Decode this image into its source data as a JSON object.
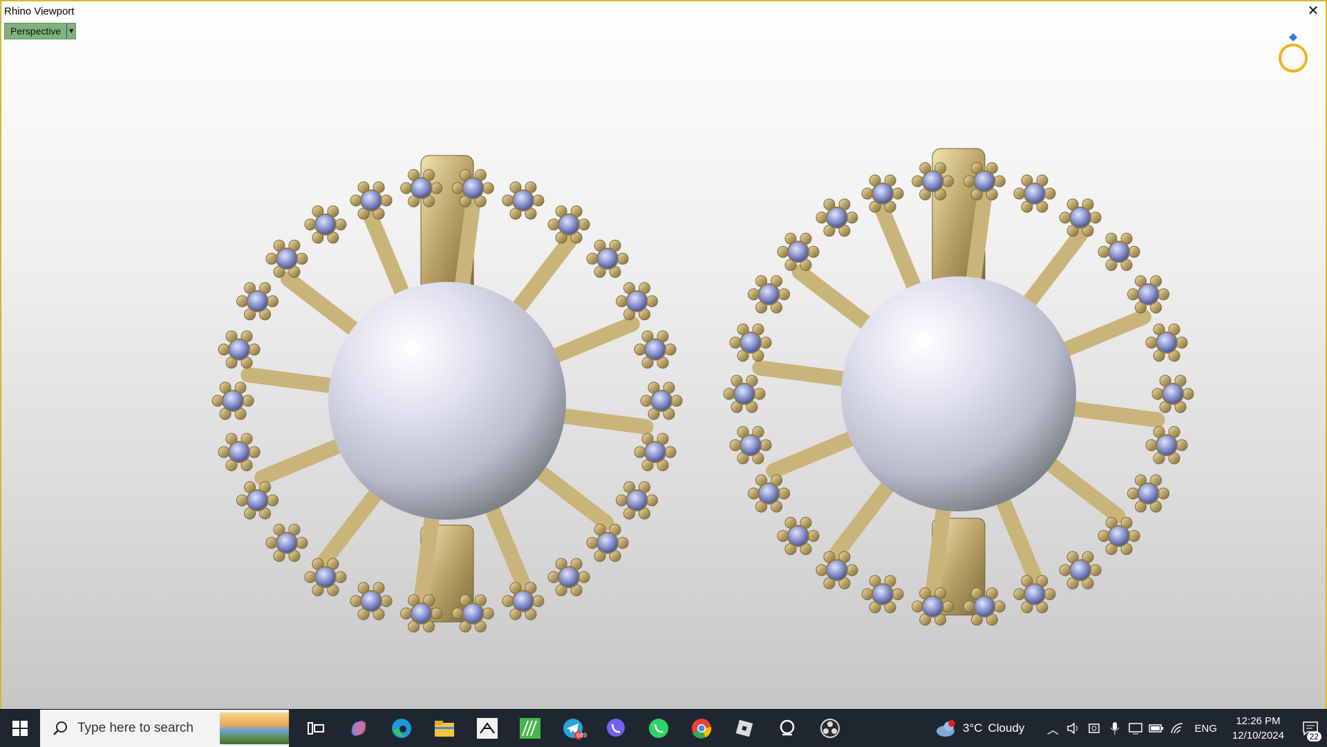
{
  "window": {
    "title": "Rhino Viewport"
  },
  "viewport": {
    "name": "Perspective"
  },
  "taskbar": {
    "search_placeholder": "Type here to search",
    "apps": [
      {
        "name": "task-view",
        "label": ""
      },
      {
        "name": "copilot",
        "label": ""
      },
      {
        "name": "edge",
        "label": ""
      },
      {
        "name": "file-explorer",
        "label": ""
      },
      {
        "name": "zbrush",
        "label": ""
      },
      {
        "name": "matrix",
        "label": ""
      },
      {
        "name": "telegram",
        "label": "689"
      },
      {
        "name": "viber",
        "label": ""
      },
      {
        "name": "whatsapp",
        "label": ""
      },
      {
        "name": "chrome",
        "label": ""
      },
      {
        "name": "roblox",
        "label": ""
      },
      {
        "name": "keyshot",
        "label": ""
      },
      {
        "name": "obs",
        "label": ""
      }
    ],
    "weather": {
      "temp": "3°C",
      "condition": "Cloudy",
      "alert": "1"
    },
    "language": "ENG",
    "time": "12:26 PM",
    "date": "12/10/2024",
    "notifications": "22"
  },
  "colors": {
    "frame": "#d8b52a",
    "viewport_tab": "#7fb27f",
    "taskbar": "#1f2630",
    "gold": "#c8b47a"
  }
}
